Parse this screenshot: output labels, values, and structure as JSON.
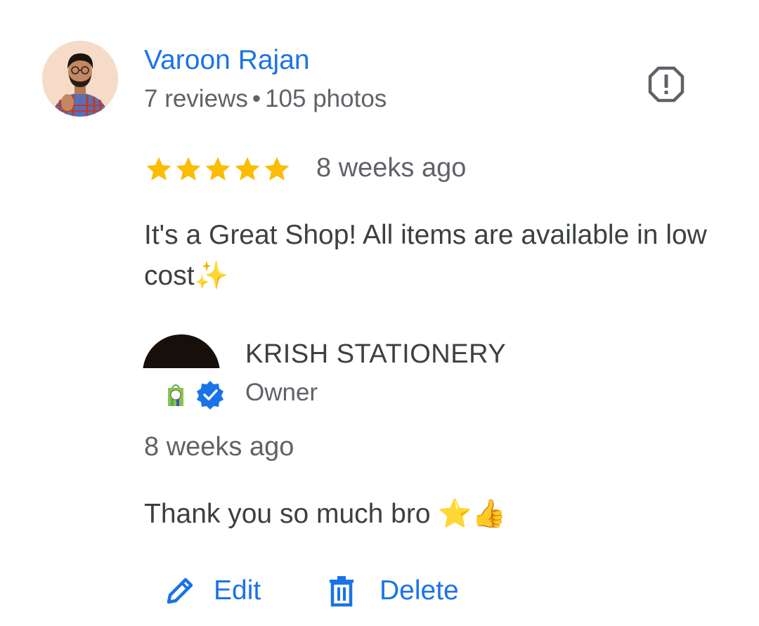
{
  "review": {
    "reviewer_name": "Varoon Rajan",
    "reviews_count": "7 reviews",
    "separator": "•",
    "photos_count": "105 photos",
    "rating": 5,
    "rating_max": 5,
    "date": "8 weeks ago",
    "text": "It's a Great Shop! All items are available in low cost✨",
    "report_icon": "report-icon"
  },
  "reply": {
    "owner_name": "KRISH STATIONERY",
    "owner_role": "Owner",
    "date": "8 weeks ago",
    "text": "Thank you so much bro ⭐👍",
    "verified_icon": "verified-badge-icon"
  },
  "actions": {
    "edit_label": "Edit",
    "delete_label": "Delete",
    "edit_icon": "pencil-icon",
    "delete_icon": "trash-icon"
  },
  "colors": {
    "accent": "#1a73e8",
    "star": "#fbbc04",
    "text_primary": "#3c4043",
    "text_secondary": "#5f6368"
  }
}
